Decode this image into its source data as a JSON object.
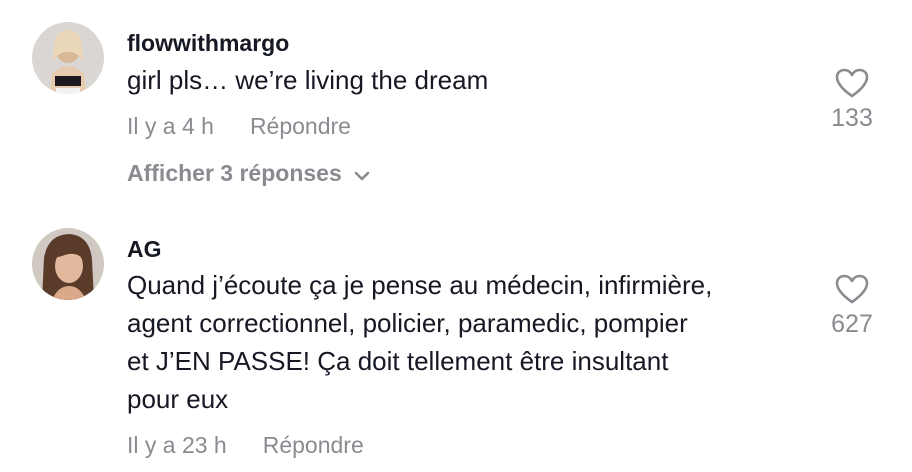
{
  "comments": [
    {
      "username": "flowwithmargo",
      "lines": [
        "girl pls… we’re living the dream"
      ],
      "time": "Il y a 4 h",
      "reply_label": "Répondre",
      "likes": "133",
      "view_replies": "Afficher 3 réponses"
    },
    {
      "username": "AG",
      "lines": [
        "Quand j’écoute ça je pense au médecin, infirmière,",
        "agent correctionnel, policier, paramedic, pompier",
        "et J’EN PASSE! Ça doit tellement être insultant",
        "pour eux"
      ],
      "time": "Il y a 23 h",
      "reply_label": "Répondre",
      "likes": "627"
    }
  ],
  "icons": {
    "like": "heart-outline-icon",
    "expand": "chevron-down-icon"
  },
  "colors": {
    "text": "#161823",
    "secondary": "#8a8b91"
  }
}
